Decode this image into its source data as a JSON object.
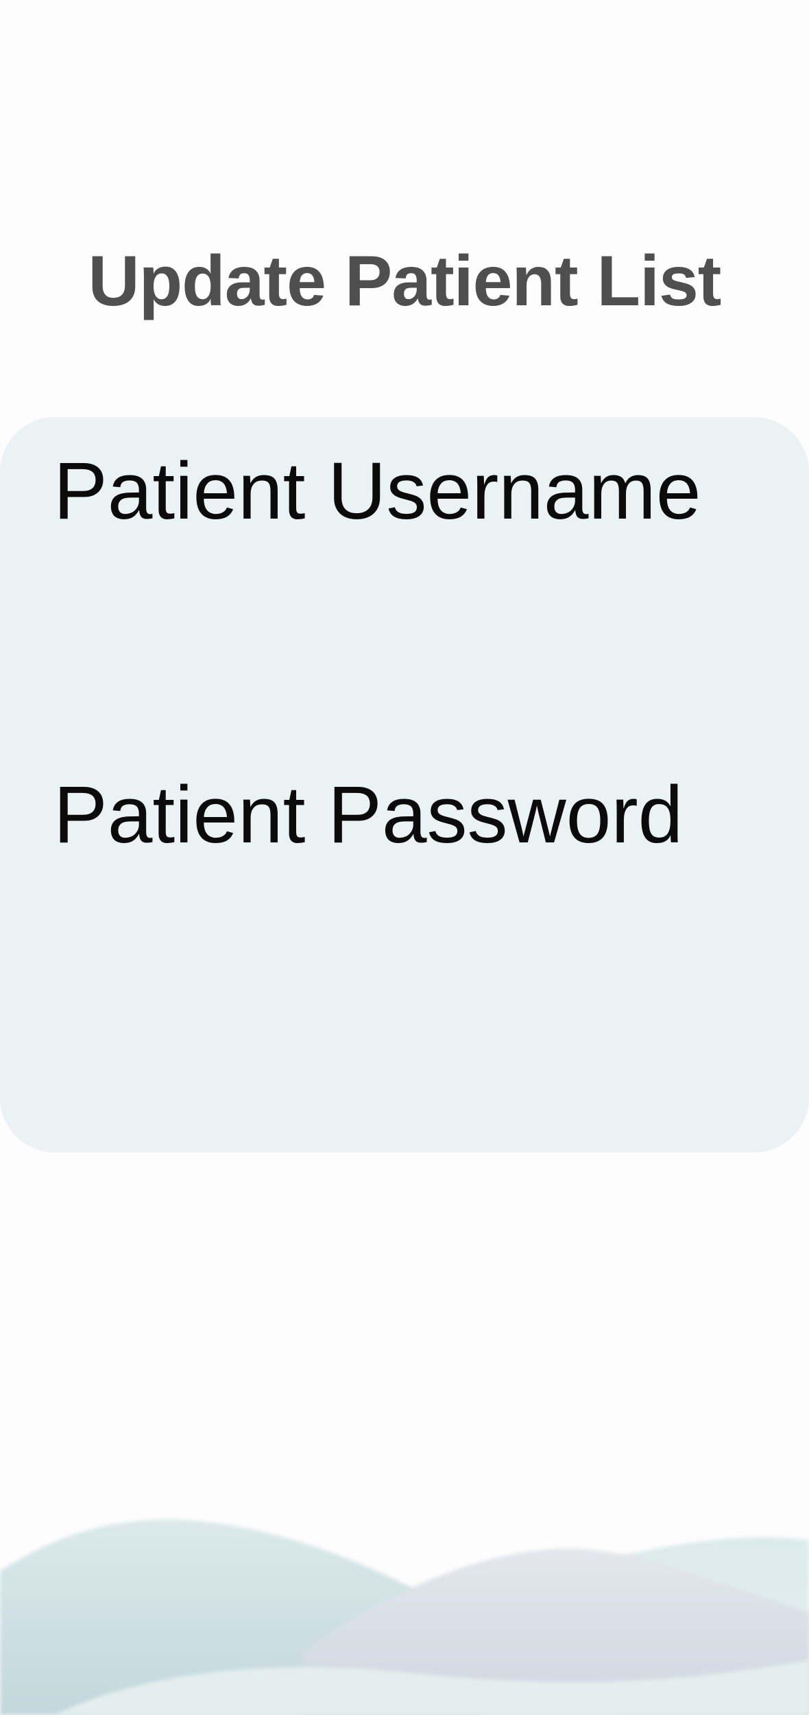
{
  "header": {
    "title": "Update Patient List"
  },
  "form": {
    "username_label": "Patient Username",
    "username_value": "",
    "password_label": "Patient Password",
    "password_value": ""
  },
  "colors": {
    "title": "#4f4f4f",
    "card_background": "#eaf2f3",
    "label_text": "#0b0b0b",
    "page_background": "#fdfdfd"
  }
}
